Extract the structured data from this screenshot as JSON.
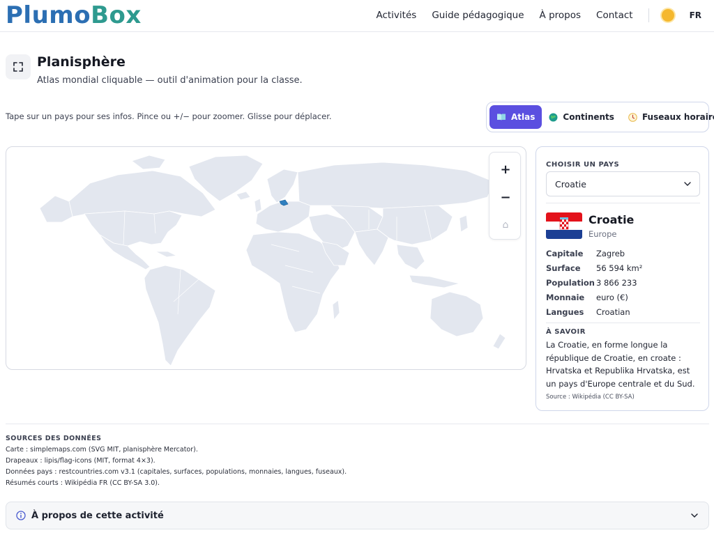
{
  "header": {
    "logo_part1": "Plumo",
    "logo_part2": "Box",
    "nav": [
      "Activités",
      "Guide pédagogique",
      "À propos",
      "Contact"
    ],
    "theme_icon": "sun-icon",
    "lang": "FR"
  },
  "page": {
    "title": "Planisphère",
    "subtitle": "Atlas mondial cliquable — outil d'animation pour la classe.",
    "instructions": "Tape sur un pays pour ses infos. Pince ou +/− pour zoomer. Glisse pour déplacer."
  },
  "modes": [
    {
      "label": "Atlas",
      "icon": "book-icon",
      "active": true
    },
    {
      "label": "Continents",
      "icon": "globe-icon",
      "active": false
    },
    {
      "label": "Fuseaux horaires",
      "icon": "clock-icon",
      "active": false
    }
  ],
  "map": {
    "zoom_in": "+",
    "zoom_out": "−",
    "home": "⌂",
    "selected_country": "Croatie",
    "land_color": "#e3e7ef",
    "border_color": "#ffffff",
    "highlight_color": "#2f7fbf"
  },
  "card": {
    "choose_label": "CHOISIR UN PAYS",
    "select_value": "Croatie",
    "country_name": "Croatie",
    "continent": "Europe",
    "facts": [
      {
        "k": "Capitale",
        "v": "Zagreb"
      },
      {
        "k": "Surface",
        "v": "56 594 km²"
      },
      {
        "k": "Population",
        "v": "3 866 233"
      },
      {
        "k": "Monnaie",
        "v": "euro (€)"
      },
      {
        "k": "Langues",
        "v": "Croatian"
      }
    ],
    "know_label": "À SAVOIR",
    "know_text": "La Croatie, en forme longue la république de Croatie, en croate : Hrvatska et Republika Hrvatska, est un pays d'Europe centrale et du Sud.",
    "source": "Source : Wikipédia (CC BY-SA)"
  },
  "sources": {
    "head": "SOURCES DES DONNÉES",
    "lines": [
      "Carte : simplemaps.com (SVG MIT, planisphère Mercator).",
      "Drapeaux : lipis/flag-icons (MIT, format 4×3).",
      "Données pays : restcountries.com v3.1 (capitales, surfaces, populations, monnaies, langues, fuseaux).",
      "Résumés courts : Wikipédia FR (CC BY-SA 3.0)."
    ]
  },
  "about": {
    "title": "À propos de cette activité"
  }
}
